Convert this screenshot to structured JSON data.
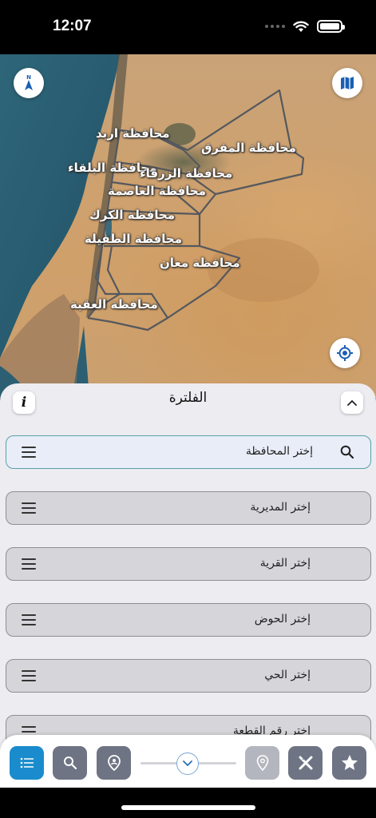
{
  "status_bar": {
    "time": "12:07"
  },
  "map": {
    "labels": [
      {
        "id": "irbid",
        "text": "محافظة اربد"
      },
      {
        "id": "mafraq",
        "text": "محافظة المفرق"
      },
      {
        "id": "balqa",
        "text": "محافظة البلقاء"
      },
      {
        "id": "zarqa",
        "text": "محافظة الزرقاء"
      },
      {
        "id": "asima",
        "text": "محافظة العاصمة"
      },
      {
        "id": "karak",
        "text": "محافظة الكرك"
      },
      {
        "id": "tafila",
        "text": "محافظة الطفيلة"
      },
      {
        "id": "maan",
        "text": "محافظة معان"
      },
      {
        "id": "aqaba",
        "text": "محافظة العقبة"
      }
    ]
  },
  "sheet": {
    "title": "الفلترة",
    "info_label": "i",
    "fields": [
      {
        "label": "إختر المحافظة",
        "active": true
      },
      {
        "label": "إختر المديرية"
      },
      {
        "label": "إختر القرية"
      },
      {
        "label": "إختر الحوض"
      },
      {
        "label": "إختر الحي"
      },
      {
        "label": "إختر رقم القطعة"
      }
    ]
  },
  "toolbar": {
    "buttons": [
      "list-icon",
      "search-icon",
      "location-person-icon",
      "pin-icon",
      "tools-icon",
      "star-icon"
    ]
  },
  "colors": {
    "primary": "#1a8ccd",
    "button": "#6e7483",
    "disabled": "#b3b6be",
    "map_border": "#55585d"
  }
}
